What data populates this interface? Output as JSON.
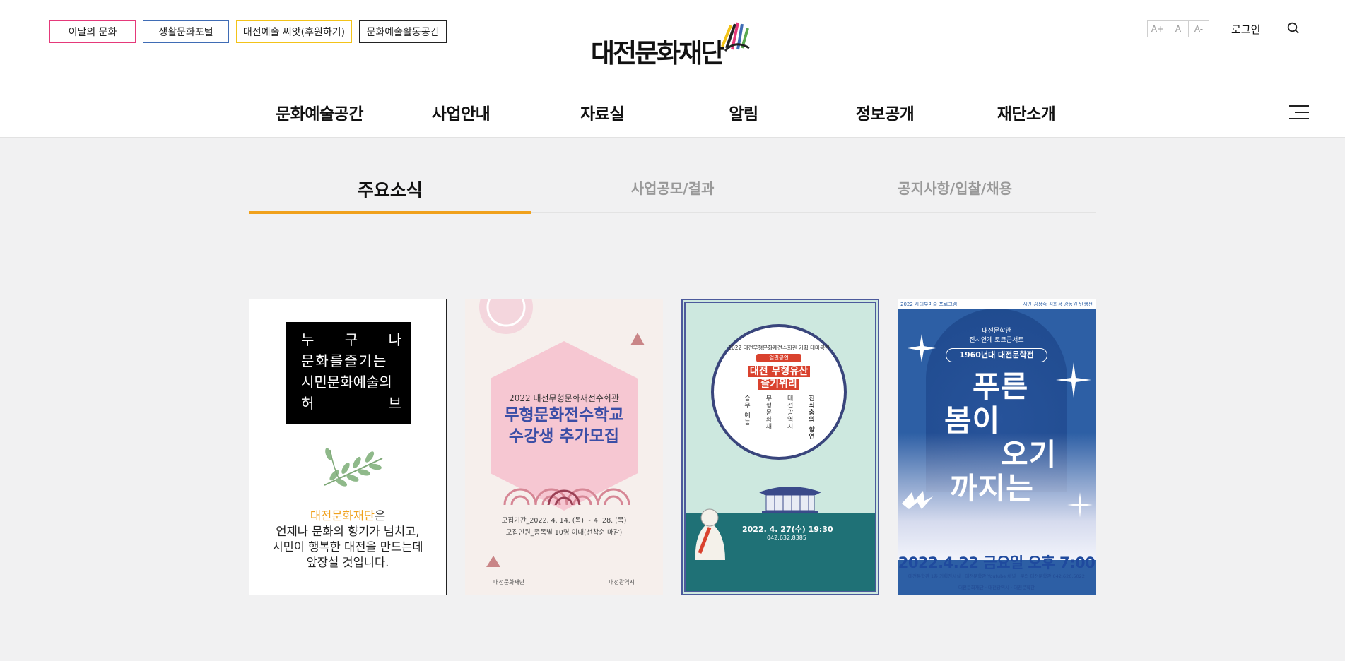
{
  "header": {
    "quick_links": [
      {
        "label": "이달의 문화",
        "color": "#e5397a"
      },
      {
        "label": "생활문화포털",
        "color": "#3f6cb5"
      },
      {
        "label": "대전예술 씨앗(후원하기)",
        "color": "#f3c319"
      },
      {
        "label": "문화예술활동공간",
        "color": "#222222"
      }
    ],
    "logo_text": "대전문화재단",
    "font_size_buttons": [
      "A+",
      "A",
      "A-"
    ],
    "login_label": "로그인",
    "search_icon": "search-icon",
    "menu_icon": "hamburger-menu-icon"
  },
  "gnb": [
    "문화예술공간",
    "사업안내",
    "자료실",
    "알림",
    "정보공개",
    "재단소개"
  ],
  "tabs": {
    "items": [
      "주요소식",
      "사업공모/결과",
      "공지사항/입찰/채용"
    ],
    "active_index": 0,
    "active_color": "#f0a11d"
  },
  "intro_card": {
    "box_lines": [
      "누 구 나",
      "문화를즐기는",
      "시민문화예술의",
      "허 브"
    ],
    "box_spread": [
      [
        "누",
        "구",
        "나"
      ],
      [
        "허",
        "브"
      ]
    ],
    "accent_name": "대전문화재단",
    "after_accent": "은",
    "lines": [
      "언제나 문화의 향기가 넘치고,",
      "시민이 행복한 대전을 만드는데",
      "앞장설 것입니다."
    ],
    "leaf_icon": "olive-branch-icon"
  },
  "posters": [
    {
      "subtitle": "2022 대전무형문화재전수회관",
      "title_lines": [
        "무형문화전수학교",
        "수강생 추가모집"
      ],
      "info_lines": [
        "모집기간_2022. 4. 14. (목) ~ 4. 28. (목)",
        "모집인원_종목별 10명 이내(선착순 마감)"
      ],
      "footer": [
        "대전문화재단",
        "대전광역시"
      ]
    },
    {
      "org": "2022 대전무형문화재전수회관 기획 테마공연",
      "badge": "열린공연",
      "title_lines": [
        "대전 무형유산",
        "즐기위리"
      ],
      "vertical_texts": [
        "진쇠춤의 향연",
        "대전광역시",
        "무형문화재",
        "승무 예능"
      ],
      "date": "2022. 4. 27(수) 19:30",
      "tel": "042.632.8385"
    },
    {
      "top_left": "2022 사대부미술 프로그램",
      "top_right": "시인 김정숙 김희정 강동원 탄생전",
      "kicker_lines": [
        "대전문학관",
        "전시연계 토크콘서트"
      ],
      "pill": "1960년대 대전문학전",
      "title_lines": [
        "푸른",
        "봄이",
        "오기",
        "까지는"
      ],
      "date": "2022.4.22 금요일 오후 7:00",
      "footer": "대전문학관 1층 기획전시실 · 대전문학관 Youtube 채널 · 문의 대전문학관 042.626.5022",
      "logos": "대전문화재단 · 대전광역시 · 대전문학관"
    }
  ]
}
